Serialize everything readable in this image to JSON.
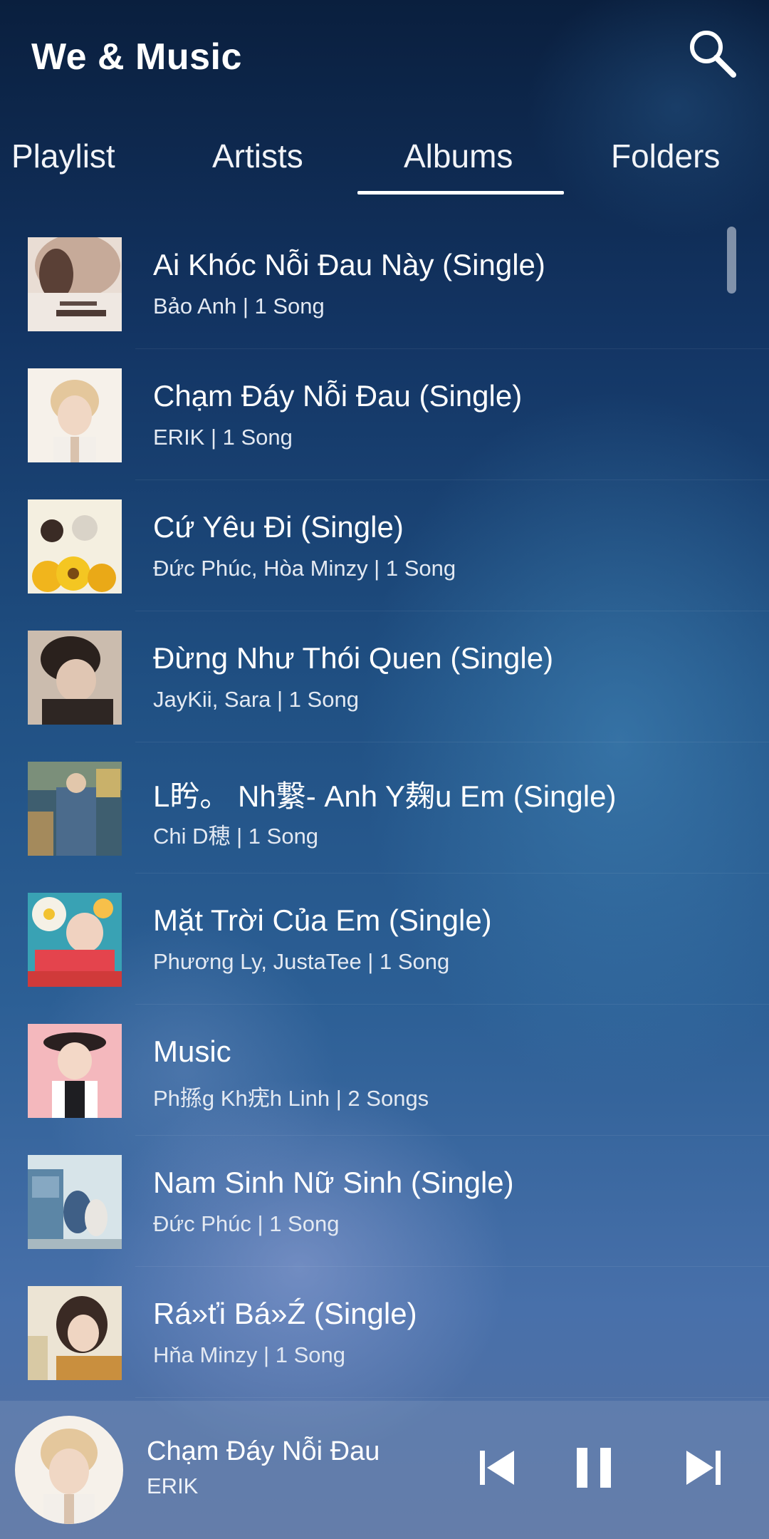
{
  "app": {
    "title": "We & Music"
  },
  "tabs": [
    {
      "label": "Playlist",
      "selected": false
    },
    {
      "label": "Artists",
      "selected": false
    },
    {
      "label": "Albums",
      "selected": true
    },
    {
      "label": "Folders",
      "selected": false
    }
  ],
  "albums": [
    {
      "title": "Ai Khóc Nỗi Đau Này (Single)",
      "meta": "Bảo Anh | 1 Song",
      "art_colors": [
        "#d9c7bd",
        "#f1e9e3"
      ]
    },
    {
      "title": "Chạm Đáy Nỗi Đau (Single)",
      "meta": "ERIK | 1 Song",
      "art_colors": [
        "#f4eee6",
        "#e9d6c0"
      ]
    },
    {
      "title": "Cứ Yêu Đi (Single)",
      "meta": "Đức Phúc, Hòa Minzy | 1 Song",
      "art_colors": [
        "#f3ecd2",
        "#f2c320"
      ]
    },
    {
      "title": "Đừng Như Thói Quen (Single)",
      "meta": "JayKii, Sara | 1 Song",
      "art_colors": [
        "#3d2f29",
        "#c9b7a7"
      ]
    },
    {
      "title": "L盻。 Nh繋- Anh Y麹u Em (Single)",
      "meta": "Chi D穂 | 1 Song",
      "art_colors": [
        "#4c6d8a",
        "#c9b16a"
      ]
    },
    {
      "title": "Mặt Trời Của Em (Single)",
      "meta": "Phương Ly, JustaTee | 1 Song",
      "art_colors": [
        "#3fa6b7",
        "#e2444c"
      ]
    },
    {
      "title": "Music",
      "meta": "Ph搎g Kh疣h Linh | 2 Songs",
      "art_colors": [
        "#f3b3b9",
        "#f9d9da"
      ]
    },
    {
      "title": "Nam Sinh Nữ Sinh (Single)",
      "meta": "Đức Phúc | 1 Song",
      "art_colors": [
        "#cfe1e8",
        "#2f5d8f"
      ]
    },
    {
      "title": "Rá»ťi Bá»Ź (Single)",
      "meta": "Hňa Minzy | 1 Song",
      "art_colors": [
        "#e9e0cf",
        "#c99a52"
      ]
    }
  ],
  "now_playing": {
    "title": "Chạm Đáy Nỗi Đau",
    "artist": "ERIK"
  },
  "icons": {
    "search": "search-icon",
    "previous": "skip-previous-icon",
    "pause": "pause-icon",
    "next": "skip-next-icon"
  }
}
